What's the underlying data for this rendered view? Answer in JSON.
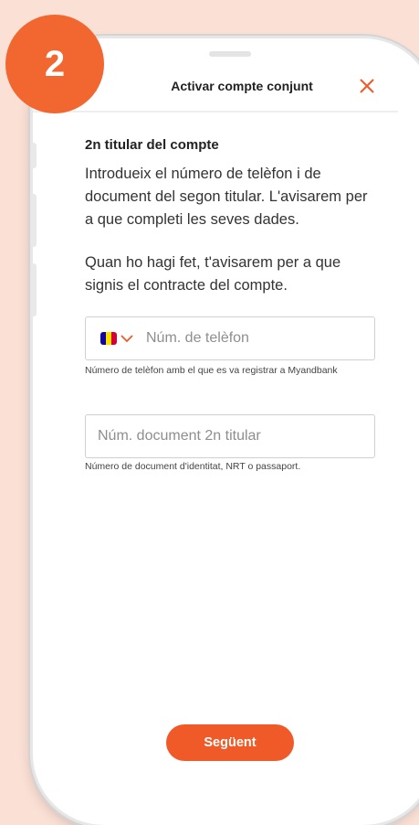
{
  "step": {
    "number": "2"
  },
  "header": {
    "title": "Activar compte conjunt"
  },
  "section": {
    "title": "2n titular del compte",
    "paragraph1": "Introdueix el número de telèfon i de document del segon titular. L'avisarem per a que completi les seves dades.",
    "paragraph2": "Quan ho hagi fet, t'avisarem per a que signis el contracte del compte."
  },
  "phone_field": {
    "placeholder": "Núm. de telèfon",
    "helper": "Número de telèfon amb el que es va registrar a Myandbank"
  },
  "document_field": {
    "placeholder": "Núm. document 2n titular",
    "helper": "Número de document d'identitat, NRT o passaport."
  },
  "footer": {
    "next_label": "Següent"
  },
  "colors": {
    "accent": "#f05a28",
    "badge": "#f2662f",
    "background": "#fbe0d5"
  },
  "icons": {
    "close": "close-icon",
    "chevron": "chevron-down-icon",
    "flag": "andorra-flag-icon",
    "back": "back-arrow-icon"
  }
}
